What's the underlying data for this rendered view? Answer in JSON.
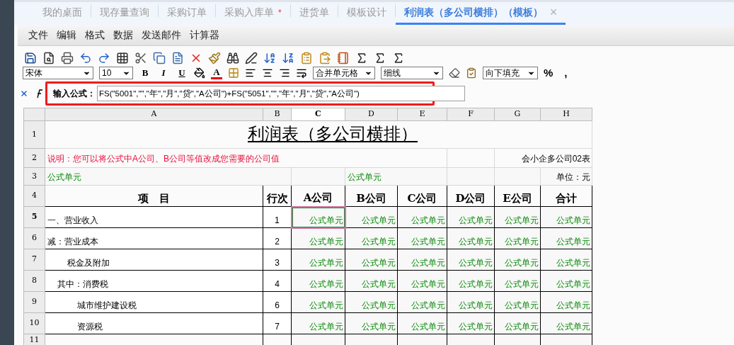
{
  "tabs": [
    {
      "label": "我的桌面",
      "selected": false
    },
    {
      "label": "现存量查询",
      "selected": false
    },
    {
      "label": "采购订单",
      "selected": false
    },
    {
      "label": "采购入库单",
      "selected": false,
      "badge": "*"
    },
    {
      "label": "进货单",
      "selected": false
    },
    {
      "label": "模板设计",
      "selected": false
    },
    {
      "label": "利润表（多公司横排）（模板）",
      "selected": true,
      "close": "×"
    }
  ],
  "menu": [
    "文件",
    "编辑",
    "格式",
    "数据",
    "发送邮件",
    "计算器"
  ],
  "toolbar": {
    "font": "宋体",
    "size": "10",
    "bold": "B",
    "italic": "I",
    "underline": "U",
    "font_color": "A",
    "merge": "合并单元格",
    "line": "细线",
    "fill": "向下填充",
    "percent": "%",
    "comma": ","
  },
  "formula": {
    "label": "输入公式：",
    "value": "FS(\"5001\",\"\",\"年\",\"月\",\"贷\",\"A公司\")+FS(\"5051\",\"\",\"年\",\"月\",\"贷\",\"A公司\")"
  },
  "sheet": {
    "columns": [
      "A",
      "B",
      "C",
      "D",
      "E",
      "F",
      "G",
      "H"
    ],
    "title": "利润表（多公司横排）",
    "note": "说明：您可以将公式中A公司、B公司等值改成您需要的公司值",
    "form_code": "会小企多公司02表",
    "row3_left": "公式单元",
    "row3_mid": "公式单元",
    "unit": "单位：元",
    "headers": [
      "项　目",
      "行次",
      "A公司",
      "B公司",
      "C公司",
      "D公司",
      "E公司",
      "合计"
    ],
    "rows": [
      {
        "kind": "top",
        "cells": [
          {
            "text": "一、营业收入",
            "selected": false
          },
          {
            "text": "1",
            "selected": false
          },
          {
            "text": "公式单元",
            "selected": true
          },
          {
            "text": "公式单元",
            "selected": false
          },
          {
            "text": "公式单元",
            "selected": false
          },
          {
            "text": "公式单元",
            "selected": false
          },
          {
            "text": "公式单元",
            "selected": false
          },
          {
            "text": "公式单元",
            "selected": false
          }
        ]
      },
      {
        "kind": "top",
        "cells": [
          {
            "text": "减：营业成本",
            "selected": false
          },
          {
            "text": "2",
            "selected": false
          },
          {
            "text": "公式单元",
            "selected": false
          },
          {
            "text": "公式单元",
            "selected": false
          },
          {
            "text": "公式单元",
            "selected": false
          },
          {
            "text": "公式单元",
            "selected": false
          },
          {
            "text": "公式单元",
            "selected": false
          },
          {
            "text": "公式单元",
            "selected": false
          }
        ]
      },
      {
        "kind": "sub",
        "cells": [
          {
            "text": "税金及附加",
            "selected": false
          },
          {
            "text": "3",
            "selected": false
          },
          {
            "text": "公式单元",
            "selected": false
          },
          {
            "text": "公式单元",
            "selected": false
          },
          {
            "text": "公式单元",
            "selected": false
          },
          {
            "text": "公式单元",
            "selected": false
          },
          {
            "text": "公式单元",
            "selected": false
          },
          {
            "text": "公式单元",
            "selected": false
          }
        ]
      },
      {
        "kind": "breakdown",
        "cells": [
          {
            "text": "其中：消费税",
            "selected": false
          },
          {
            "text": "4",
            "selected": false
          },
          {
            "text": "公式单元",
            "selected": false
          },
          {
            "text": "公式单元",
            "selected": false
          },
          {
            "text": "公式单元",
            "selected": false
          },
          {
            "text": "公式单元",
            "selected": false
          },
          {
            "text": "公式单元",
            "selected": false
          },
          {
            "text": "公式单元",
            "selected": false
          }
        ]
      },
      {
        "kind": "detail",
        "cells": [
          {
            "text": "城市维护建设税",
            "selected": false
          },
          {
            "text": "6",
            "selected": false
          },
          {
            "text": "公式单元",
            "selected": false
          },
          {
            "text": "公式单元",
            "selected": false
          },
          {
            "text": "公式单元",
            "selected": false
          },
          {
            "text": "公式单元",
            "selected": false
          },
          {
            "text": "公式单元",
            "selected": false
          },
          {
            "text": "公式单元",
            "selected": false
          }
        ]
      },
      {
        "kind": "detail",
        "cells": [
          {
            "text": "资源税",
            "selected": false
          },
          {
            "text": "7",
            "selected": false
          },
          {
            "text": "公式单元",
            "selected": false
          },
          {
            "text": "公式单元",
            "selected": false
          },
          {
            "text": "公式单元",
            "selected": false
          },
          {
            "text": "公式单元",
            "selected": false
          },
          {
            "text": "公式单元",
            "selected": false
          },
          {
            "text": "公式单元",
            "selected": false
          }
        ]
      }
    ],
    "row_numbers": [
      "1",
      "2",
      "3",
      "4",
      "5",
      "6",
      "7",
      "8",
      "9",
      "10",
      "11"
    ]
  }
}
